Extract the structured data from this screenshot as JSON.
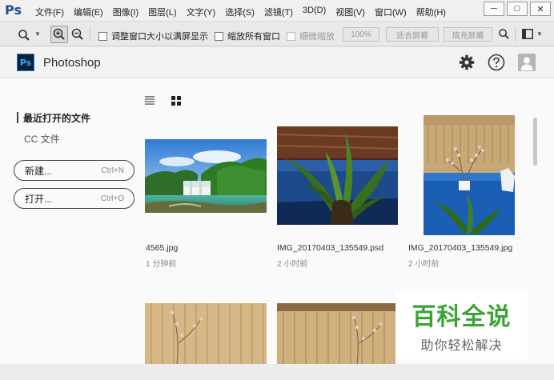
{
  "app": {
    "logo_text": "Ps",
    "menu": [
      "文件(F)",
      "编辑(E)",
      "图像(I)",
      "图层(L)",
      "文字(Y)",
      "选择(S)",
      "滤镜(T)",
      "3D(D)",
      "视图(V)",
      "窗口(W)",
      "帮助(H)"
    ],
    "window_controls": {
      "minimize": "─",
      "maximize": "□",
      "close": "✕"
    }
  },
  "options_bar": {
    "resize_windows_label": "调整窗口大小以满屏显示",
    "zoom_all_label": "缩放所有窗口",
    "scrubby_zoom_label": "细微缩放",
    "zoom_percent_label": "100%",
    "fit_screen_label": "适合屏幕",
    "fill_screen_label": "填充屏幕"
  },
  "start": {
    "logo_text": "Ps",
    "title": "Photoshop",
    "sidebar": {
      "recent_label": "最近打开的文件",
      "cc_files_label": "CC 文件",
      "new_label": "新建...",
      "new_shortcut": "Ctrl+N",
      "open_label": "打开...",
      "open_shortcut": "Ctrl+O"
    },
    "files": [
      {
        "name": "4565.jpg",
        "time": "1 分钟前"
      },
      {
        "name": "IMG_20170403_135549.psd",
        "time": "2 小时前"
      },
      {
        "name": "IMG_20170403_135549.jpg",
        "time": "2 小时前"
      }
    ]
  },
  "watermark": {
    "main": "百科全说",
    "sub": "助你轻松解决"
  },
  "colors": {
    "ps_blue": "#31a8ff",
    "watermark_green": "#3aa535"
  }
}
